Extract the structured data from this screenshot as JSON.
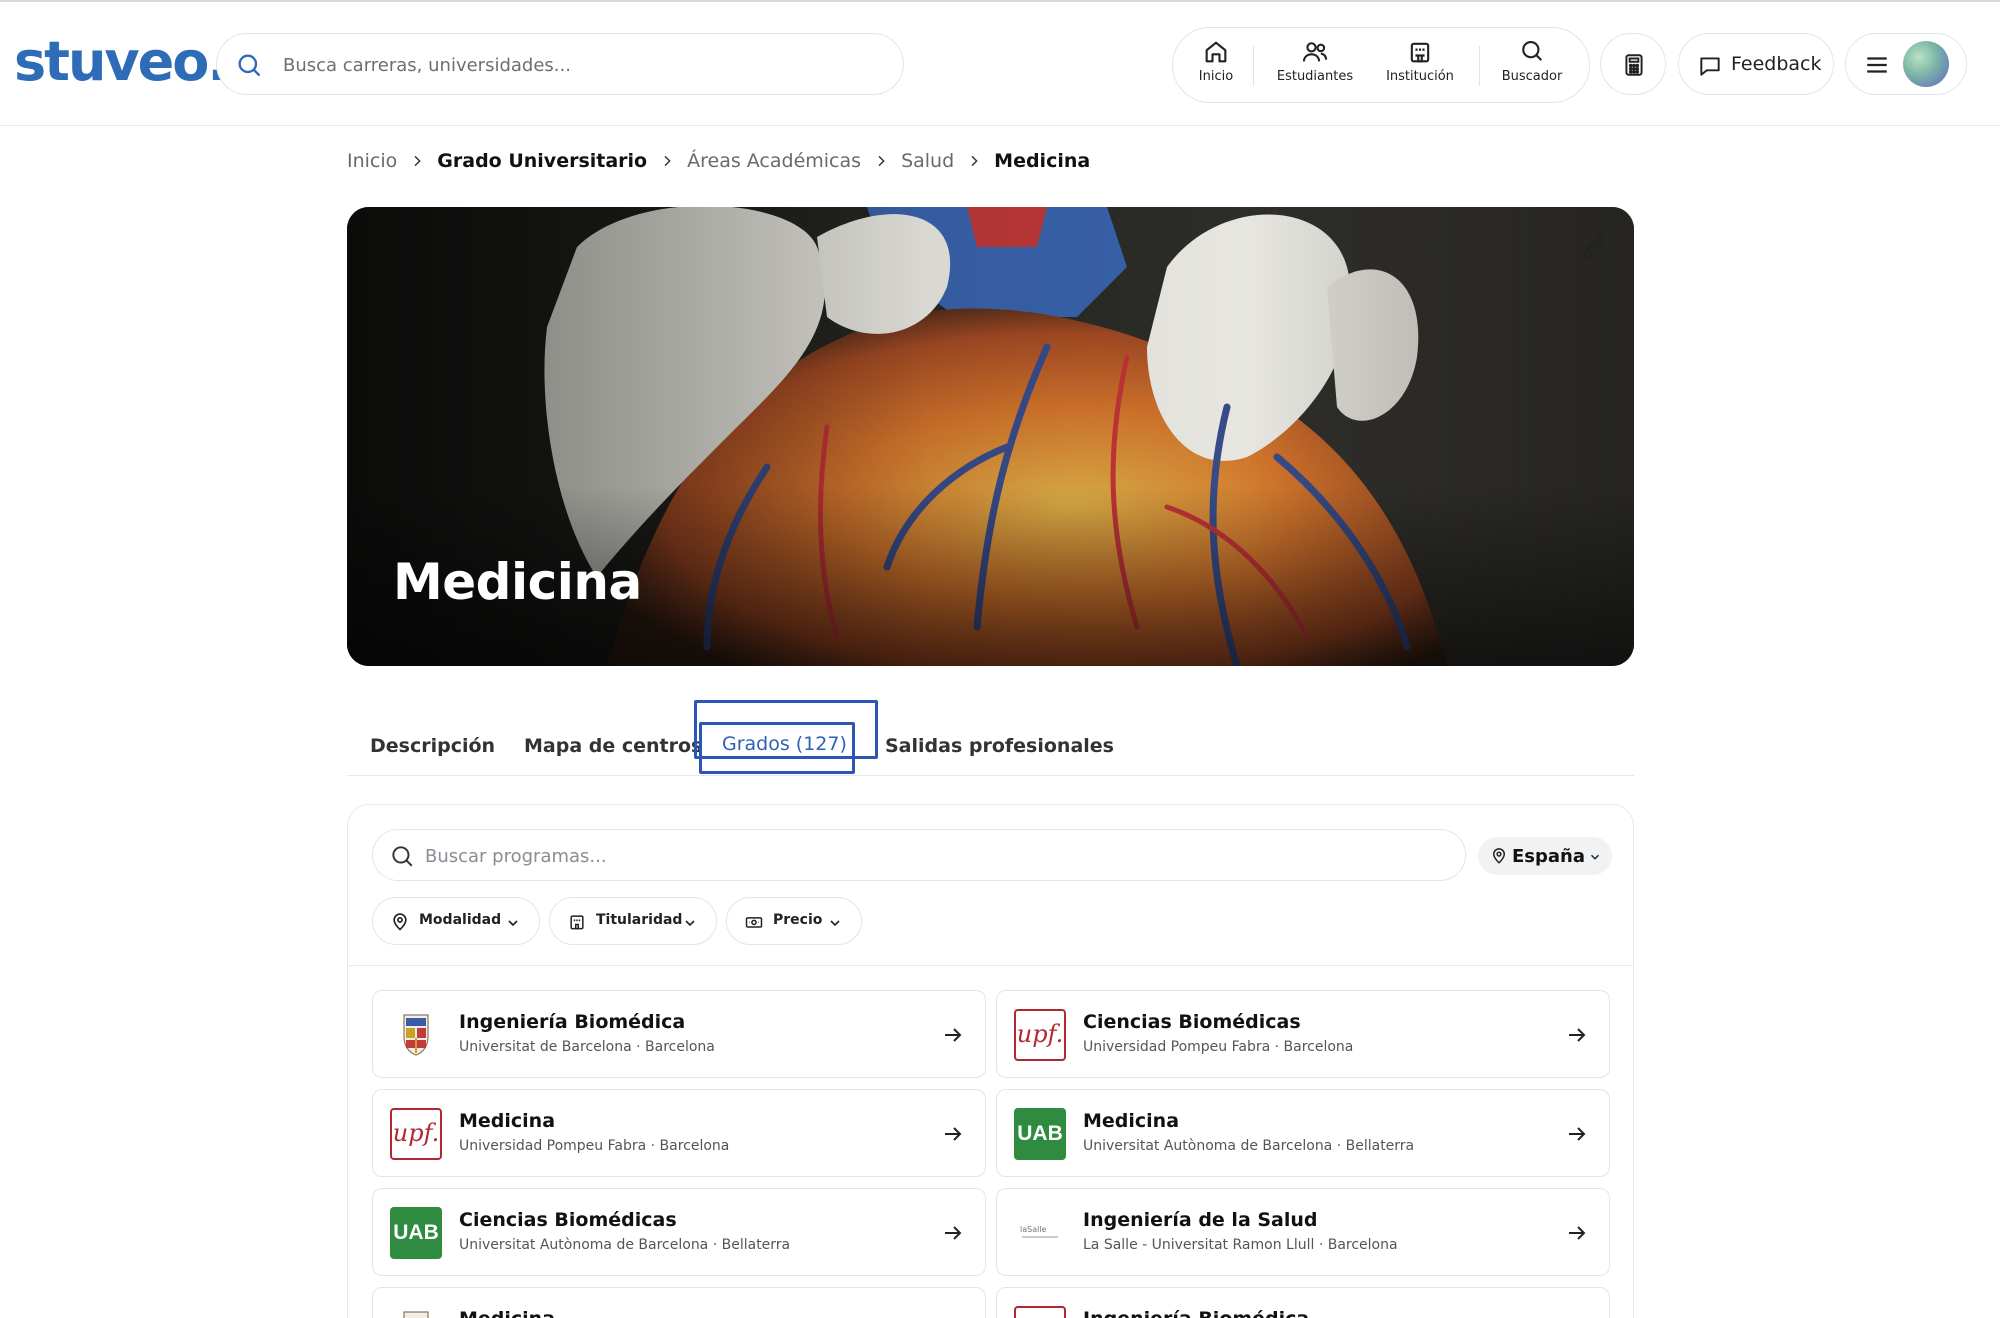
{
  "brand": {
    "logo_text": "stuveo.",
    "color": "#2f6cb7"
  },
  "header": {
    "search_placeholder": "Busca carreras, universidades...",
    "nav": [
      {
        "label": "Inicio",
        "icon": "home-icon"
      },
      {
        "label": "Estudiantes",
        "icon": "users-icon"
      },
      {
        "label": "Institución",
        "icon": "building-icon"
      },
      {
        "label": "Buscador",
        "icon": "search-icon"
      }
    ],
    "calculator_icon": "calculator-icon",
    "feedback_label": "Feedback",
    "menu_icon": "hamburger-menu-icon"
  },
  "breadcrumb": [
    {
      "label": "Inicio",
      "bold": false
    },
    {
      "label": "Grado Universitario",
      "bold": true
    },
    {
      "label": "Áreas Académicas",
      "bold": false
    },
    {
      "label": "Salud",
      "bold": false
    },
    {
      "label": "Medicina",
      "bold": true
    }
  ],
  "hero": {
    "title": "Medicina",
    "edit_icon": "pencil-icon"
  },
  "tabs": [
    {
      "label": "Descripción",
      "active": false
    },
    {
      "label": "Mapa de centros",
      "active": false
    },
    {
      "label": "Grados (127)",
      "active": true
    },
    {
      "label": "Salidas profesionales",
      "active": false
    }
  ],
  "programs": {
    "search_placeholder": "Buscar programas...",
    "location": "España",
    "filters": [
      {
        "label": "Modalidad",
        "icon": "location-pin-icon"
      },
      {
        "label": "Titularidad",
        "icon": "building-icon"
      },
      {
        "label": "Precio",
        "icon": "money-icon"
      }
    ],
    "cards": [
      {
        "title": "Ingeniería Biomédica",
        "subtitle": "Universitat de Barcelona · Barcelona",
        "logo": "ub"
      },
      {
        "title": "Ciencias Biomédicas",
        "subtitle": "Universidad Pompeu Fabra · Barcelona",
        "logo": "upf"
      },
      {
        "title": "Medicina",
        "subtitle": "Universidad Pompeu Fabra · Barcelona",
        "logo": "upf"
      },
      {
        "title": "Medicina",
        "subtitle": "Universitat Autònoma de Barcelona · Bellaterra",
        "logo": "uab"
      },
      {
        "title": "Ciencias Biomédicas",
        "subtitle": "Universitat Autònoma de Barcelona · Bellaterra",
        "logo": "uab"
      },
      {
        "title": "Ingeniería de la Salud",
        "subtitle": "La Salle - Universitat Ramon Llull · Barcelona",
        "logo": "lasalle"
      },
      {
        "title": "Medicina",
        "subtitle": "",
        "logo": "ub"
      },
      {
        "title": "Ingeniería Biomédica",
        "subtitle": "",
        "logo": "upf"
      }
    ],
    "logo_texts": {
      "upf": "upf.",
      "uab": "UAB",
      "lasalle": "laSalle"
    }
  },
  "colors": {
    "accent": "#2f62b5",
    "focus_outline": "#2d55b8",
    "uab_green": "#2e8b3f",
    "upf_red": "#b3272f"
  }
}
